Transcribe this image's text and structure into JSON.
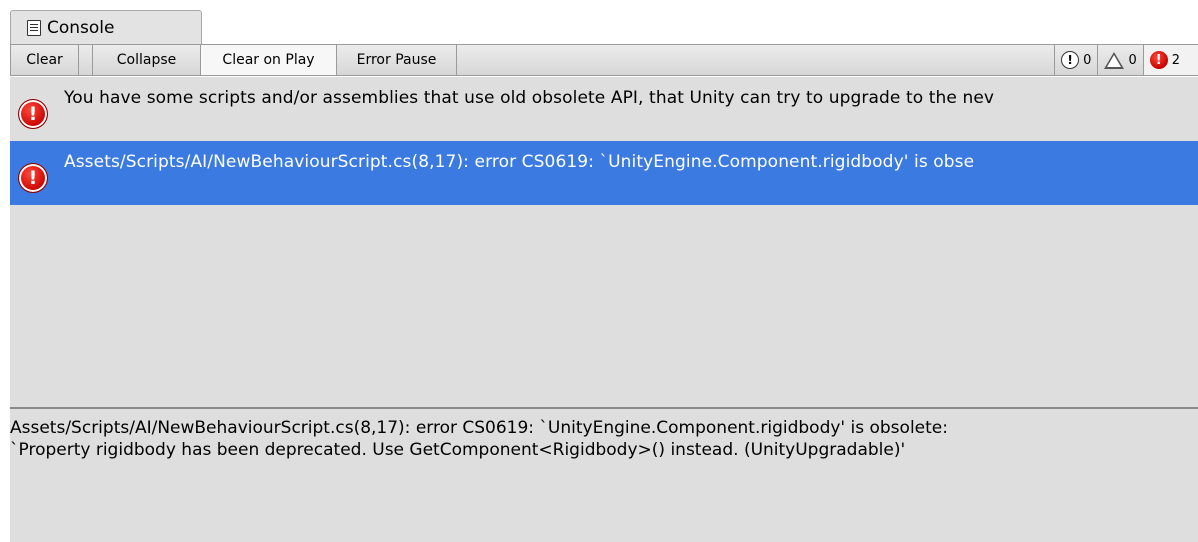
{
  "tab": {
    "title": "Console",
    "icon": "document-icon"
  },
  "toolbar": {
    "clear_label": "Clear",
    "collapse_label": "Collapse",
    "clear_on_play_label": "Clear on Play",
    "error_pause_label": "Error Pause",
    "counts": {
      "info": "0",
      "warnings": "0",
      "errors": "2"
    }
  },
  "entries": [
    {
      "type": "error",
      "text": "You have some scripts and/or assemblies that use old obsolete API, that Unity can try to upgrade to the nev",
      "selected": false
    },
    {
      "type": "error",
      "text": "Assets/Scripts/AI/NewBehaviourScript.cs(8,17): error CS0619: `UnityEngine.Component.rigidbody' is obse",
      "selected": true
    }
  ],
  "detail": {
    "line1": "Assets/Scripts/AI/NewBehaviourScript.cs(8,17): error CS0619: `UnityEngine.Component.rigidbody' is obsolete:",
    "line2": "`Property rigidbody has been deprecated. Use GetComponent<Rigidbody>() instead. (UnityUpgradable)'"
  },
  "colors": {
    "selection": "#3b7ae0",
    "error": "#d40000",
    "panel": "#dedede"
  }
}
